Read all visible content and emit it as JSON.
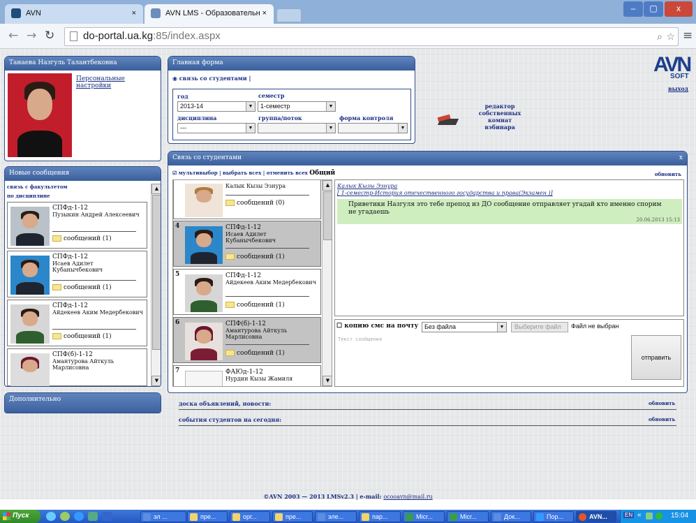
{
  "browser": {
    "tabs": [
      {
        "title": "AVN"
      },
      {
        "title": "AVN LMS - Образовательн"
      }
    ],
    "url_host": "do-portal.ua.kg",
    "url_path": ":85/index.aspx",
    "close": "×",
    "win_min": "‒",
    "win_max": "▢",
    "win_close": "x"
  },
  "profile": {
    "name": "Танаева Назгуль Талантбековна",
    "settings_link": "Персональные настройки"
  },
  "main_form": {
    "title": "Главная форма",
    "radio_label": "связь со студентами",
    "sep": "|",
    "year_label": "год",
    "year_value": "2013-14",
    "semester_label": "семестр",
    "semester_value": "1-семестр",
    "discipline_label": "дисциплина",
    "discipline_value": "---",
    "group_label": "группа/поток",
    "control_label": "форма контроля"
  },
  "editor_link": "редактор собственных комнат вэбинара",
  "logout": "выход",
  "logo": {
    "main": "AVN",
    "sub": "SOFT"
  },
  "news": {
    "title": "Новые сообщения",
    "cat1": "связь с факультетом",
    "cat2": "по дисциплине",
    "items": [
      {
        "group": "СПФд-1-12",
        "name": "Пузыкин Андрей Алексеевич",
        "msgs": "сообщений (1)"
      },
      {
        "group": "СПФд-1-12",
        "name": "Исаев Адилет Кубанычбекович",
        "msgs": "сообщений (1)"
      },
      {
        "group": "СПФд-1-12",
        "name": "Айдекеев Аким Медербекович",
        "msgs": "сообщений (1)"
      },
      {
        "group": "СПФ(б)-1-12",
        "name": "Амантурова Айткуль Марлисовна",
        "msgs": "сообщений (1)"
      }
    ]
  },
  "extra": {
    "title": "Дополнительно"
  },
  "chat": {
    "title": "Связь со студентами",
    "close": "x",
    "multiselect": "мультивыбор",
    "select_all": "выбрать всех",
    "deselect_all": "отменить всех",
    "general": "Общий",
    "refresh": "обновить",
    "students": [
      {
        "num": "",
        "group": "",
        "name": "Калык Кызы Эзнура",
        "msgs": "сообщений (0)"
      },
      {
        "num": "4",
        "group": "СПФд-1-12",
        "name": "Исаев Адилет Кубанычбекович",
        "msgs": "сообщений (1)"
      },
      {
        "num": "5",
        "group": "СПФд-1-12",
        "name": "Айдекеев Аким Медербекович",
        "msgs": "сообщений (1)"
      },
      {
        "num": "6",
        "group": "СПФ(б)-1-12",
        "name": "Амантурова Айткуль Марлисовна",
        "msgs": "сообщений (1)"
      },
      {
        "num": "7",
        "group": "ФАЮд-1-12",
        "name": "Нурдин Кызы Жамиля",
        "msgs": ""
      }
    ],
    "thread_user": "Калык Кызы Эзнура",
    "thread_subject": "[ 1-семестр-История отечественного государства и права(Экзамен )]",
    "message_text": "Приветики Назгуля это тебе препод из ДО сообщение отправляет угадай кто именно спорим не угадаешь",
    "message_time": "20.06.2013 15:13",
    "copy_sms": "копию смс на почту",
    "file_select": "Без файла",
    "choose_file": "Выберите файл",
    "no_file": "Файл не выбран",
    "placeholder": "Текст сообщения",
    "send": "отправить"
  },
  "board": {
    "title": "доска объявлений, новости:",
    "refresh": "обновить"
  },
  "events": {
    "title": "события студентов на сегодня:",
    "refresh": "обновить"
  },
  "footer": {
    "text": "©AVN 2003 — 2013 LMSv2.3 | e-mail: ",
    "email": "ocooavn@mail.ru"
  },
  "taskbar": {
    "start": "Пуск",
    "items": [
      "эл ...",
      "пре...",
      "орг...",
      "пре...",
      "эле...",
      "пар...",
      "Micr...",
      "Micr...",
      "Док...",
      "Пор...",
      "AVN..."
    ],
    "lang": "EN",
    "time": "15:04"
  }
}
